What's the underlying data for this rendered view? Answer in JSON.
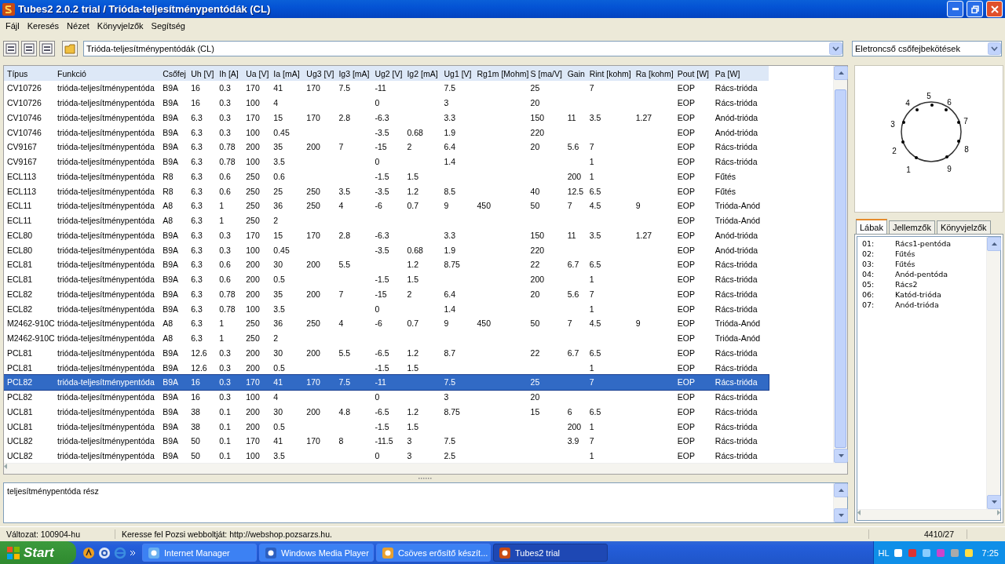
{
  "window": {
    "title": "Tubes2 2.0.2 trial / Trióda-teljesítménypentódák (CL)"
  },
  "menu": [
    "Fájl",
    "Keresés",
    "Nézet",
    "Könyvjelzők",
    "Segítség"
  ],
  "toolbar": {
    "category": "Trióda-teljesítménypentódák (CL)",
    "view": "Eletroncső csőfejbekötések"
  },
  "table": {
    "columns": [
      "Típus",
      "Funkció",
      "Csőfej",
      "Uh [V]",
      "Ih [A]",
      "Ua [V]",
      "Ia [mA]",
      "Ug3 [V]",
      "Ig3 [mA]",
      "Ug2 [V]",
      "Ig2 [mA]",
      "Ug1 [V]",
      "Rg1m [Mohm]",
      "S [ma/V]",
      "Gain",
      "Rint [kohm]",
      "Ra [kohm]",
      "Pout [W]",
      "Pa [W]"
    ],
    "rows": [
      {
        "selected": false,
        "cells": [
          "CV10726",
          "trióda-teljesítménypentóda",
          "B9A",
          "16",
          "0.3",
          "170",
          "41",
          "170",
          "7.5",
          "-11",
          null,
          "7.5",
          null,
          "25",
          null,
          "7",
          null,
          "EOP",
          "Rács-trióda"
        ]
      },
      {
        "selected": false,
        "cells": [
          "CV10726",
          "trióda-teljesítménypentóda",
          "B9A",
          "16",
          "0.3",
          "100",
          "4",
          null,
          null,
          "0",
          null,
          "3",
          null,
          "20",
          null,
          null,
          null,
          "EOP",
          "Rács-trióda"
        ]
      },
      {
        "selected": false,
        "cells": [
          "CV10746",
          "trióda-teljesítménypentóda",
          "B9A",
          "6.3",
          "0.3",
          "170",
          "15",
          "170",
          "2.8",
          "-6.3",
          null,
          "3.3",
          null,
          "150",
          "11",
          "3.5",
          "1.27",
          "EOP",
          "Anód-trióda"
        ]
      },
      {
        "selected": false,
        "cells": [
          "CV10746",
          "trióda-teljesítménypentóda",
          "B9A",
          "6.3",
          "0.3",
          "100",
          "0.45",
          null,
          null,
          "-3.5",
          "0.68",
          "1.9",
          null,
          "220",
          null,
          null,
          null,
          "EOP",
          "Anód-trióda"
        ]
      },
      {
        "selected": false,
        "cells": [
          "CV9167",
          "trióda-teljesítménypentóda",
          "B9A",
          "6.3",
          "0.78",
          "200",
          "35",
          "200",
          "7",
          "-15",
          "2",
          "6.4",
          null,
          "20",
          "5.6",
          "7",
          null,
          "EOP",
          "Rács-trióda"
        ]
      },
      {
        "selected": false,
        "cells": [
          "CV9167",
          "trióda-teljesítménypentóda",
          "B9A",
          "6.3",
          "0.78",
          "100",
          "3.5",
          null,
          null,
          "0",
          null,
          "1.4",
          null,
          null,
          null,
          "1",
          null,
          "EOP",
          "Rács-trióda"
        ]
      },
      {
        "selected": false,
        "cells": [
          "ECL113",
          "trióda-teljesítménypentóda",
          "R8",
          "6.3",
          "0.6",
          "250",
          "0.6",
          null,
          null,
          "-1.5",
          "1.5",
          null,
          null,
          null,
          "200",
          "1",
          null,
          "EOP",
          "Fűtés"
        ]
      },
      {
        "selected": false,
        "cells": [
          "ECL113",
          "trióda-teljesítménypentóda",
          "R8",
          "6.3",
          "0.6",
          "250",
          "25",
          "250",
          "3.5",
          "-3.5",
          "1.2",
          "8.5",
          null,
          "40",
          "12.5",
          "6.5",
          null,
          "EOP",
          "Fűtés"
        ]
      },
      {
        "selected": false,
        "cells": [
          "ECL11",
          "trióda-teljesítménypentóda",
          "A8",
          "6.3",
          "1",
          "250",
          "36",
          "250",
          "4",
          "-6",
          "0.7",
          "9",
          "450",
          "50",
          "7",
          "4.5",
          "9",
          "EOP",
          "Trióda-Anód"
        ]
      },
      {
        "selected": false,
        "cells": [
          "ECL11",
          "trióda-teljesítménypentóda",
          "A8",
          "6.3",
          "1",
          "250",
          "2",
          null,
          null,
          null,
          null,
          null,
          null,
          null,
          null,
          null,
          null,
          "EOP",
          "Trióda-Anód"
        ]
      },
      {
        "selected": false,
        "cells": [
          "ECL80",
          "trióda-teljesítménypentóda",
          "B9A",
          "6.3",
          "0.3",
          "170",
          "15",
          "170",
          "2.8",
          "-6.3",
          null,
          "3.3",
          null,
          "150",
          "11",
          "3.5",
          "1.27",
          "EOP",
          "Anód-trióda"
        ]
      },
      {
        "selected": false,
        "cells": [
          "ECL80",
          "trióda-teljesítménypentóda",
          "B9A",
          "6.3",
          "0.3",
          "100",
          "0.45",
          null,
          null,
          "-3.5",
          "0.68",
          "1.9",
          null,
          "220",
          null,
          null,
          null,
          "EOP",
          "Anód-trióda"
        ]
      },
      {
        "selected": false,
        "cells": [
          "ECL81",
          "trióda-teljesítménypentóda",
          "B9A",
          "6.3",
          "0.6",
          "200",
          "30",
          "200",
          "5.5",
          null,
          "1.2",
          "8.75",
          null,
          "22",
          "6.7",
          "6.5",
          null,
          "EOP",
          "Rács-trióda"
        ]
      },
      {
        "selected": false,
        "cells": [
          "ECL81",
          "trióda-teljesítménypentóda",
          "B9A",
          "6.3",
          "0.6",
          "200",
          "0.5",
          null,
          null,
          "-1.5",
          "1.5",
          null,
          null,
          "200",
          null,
          "1",
          null,
          "EOP",
          "Rács-trióda"
        ]
      },
      {
        "selected": false,
        "cells": [
          "ECL82",
          "trióda-teljesítménypentóda",
          "B9A",
          "6.3",
          "0.78",
          "200",
          "35",
          "200",
          "7",
          "-15",
          "2",
          "6.4",
          null,
          "20",
          "5.6",
          "7",
          null,
          "EOP",
          "Rács-trióda"
        ]
      },
      {
        "selected": false,
        "cells": [
          "ECL82",
          "trióda-teljesítménypentóda",
          "B9A",
          "6.3",
          "0.78",
          "100",
          "3.5",
          null,
          null,
          "0",
          null,
          "1.4",
          null,
          null,
          null,
          "1",
          null,
          "EOP",
          "Rács-trióda"
        ]
      },
      {
        "selected": false,
        "cells": [
          "M2462-910C",
          "trióda-teljesítménypentóda",
          "A8",
          "6.3",
          "1",
          "250",
          "36",
          "250",
          "4",
          "-6",
          "0.7",
          "9",
          "450",
          "50",
          "7",
          "4.5",
          "9",
          "EOP",
          "Trióda-Anód"
        ]
      },
      {
        "selected": false,
        "cells": [
          "M2462-910C",
          "trióda-teljesítménypentóda",
          "A8",
          "6.3",
          "1",
          "250",
          "2",
          null,
          null,
          null,
          null,
          null,
          null,
          null,
          null,
          null,
          null,
          "EOP",
          "Trióda-Anód"
        ]
      },
      {
        "selected": false,
        "cells": [
          "PCL81",
          "trióda-teljesítménypentóda",
          "B9A",
          "12.6",
          "0.3",
          "200",
          "30",
          "200",
          "5.5",
          "-6.5",
          "1.2",
          "8.7",
          null,
          "22",
          "6.7",
          "6.5",
          null,
          "EOP",
          "Rács-trióda"
        ]
      },
      {
        "selected": false,
        "cells": [
          "PCL81",
          "trióda-teljesítménypentóda",
          "B9A",
          "12.6",
          "0.3",
          "200",
          "0.5",
          null,
          null,
          "-1.5",
          "1.5",
          null,
          null,
          null,
          null,
          "1",
          null,
          "EOP",
          "Rács-trióda"
        ]
      },
      {
        "selected": true,
        "cells": [
          "PCL82",
          "trióda-teljesítménypentóda",
          "B9A",
          "16",
          "0.3",
          "170",
          "41",
          "170",
          "7.5",
          "-11",
          null,
          "7.5",
          null,
          "25",
          null,
          "7",
          null,
          "EOP",
          "Rács-trióda"
        ]
      },
      {
        "selected": false,
        "cells": [
          "PCL82",
          "trióda-teljesítménypentóda",
          "B9A",
          "16",
          "0.3",
          "100",
          "4",
          null,
          null,
          "0",
          null,
          "3",
          null,
          "20",
          null,
          null,
          null,
          "EOP",
          "Rács-trióda"
        ]
      },
      {
        "selected": false,
        "cells": [
          "UCL81",
          "trióda-teljesítménypentóda",
          "B9A",
          "38",
          "0.1",
          "200",
          "30",
          "200",
          "4.8",
          "-6.5",
          "1.2",
          "8.75",
          null,
          "15",
          "6",
          "6.5",
          null,
          "EOP",
          "Rács-trióda"
        ]
      },
      {
        "selected": false,
        "cells": [
          "UCL81",
          "trióda-teljesítménypentóda",
          "B9A",
          "38",
          "0.1",
          "200",
          "0.5",
          null,
          null,
          "-1.5",
          "1.5",
          null,
          null,
          null,
          "200",
          "1",
          null,
          "EOP",
          "Rács-trióda"
        ]
      },
      {
        "selected": false,
        "cells": [
          "UCL82",
          "trióda-teljesítménypentóda",
          "B9A",
          "50",
          "0.1",
          "170",
          "41",
          "170",
          "8",
          "-11.5",
          "3",
          "7.5",
          null,
          null,
          "3.9",
          "7",
          null,
          "EOP",
          "Rács-trióda"
        ]
      },
      {
        "selected": false,
        "cells": [
          "UCL82",
          "trióda-teljesítménypentóda",
          "B9A",
          "50",
          "0.1",
          "100",
          "3.5",
          null,
          null,
          "0",
          "3",
          "2.5",
          null,
          null,
          null,
          "1",
          null,
          "EOP",
          "Rács-trióda"
        ]
      }
    ]
  },
  "description": "teljesítménypentóda rész",
  "pin_diagram": {
    "pins": [
      "1",
      "2",
      "3",
      "4",
      "5",
      "6",
      "7",
      "8",
      "9"
    ]
  },
  "side_tabs": [
    {
      "label": "Lábak",
      "selected": true
    },
    {
      "label": "Jellemzők",
      "selected": false
    },
    {
      "label": "Könyvjelzők",
      "selected": false
    }
  ],
  "pin_list": [
    {
      "number": "01:",
      "name": "Rács1-pentóda"
    },
    {
      "number": "02:",
      "name": "Fűtés"
    },
    {
      "number": "03:",
      "name": "Fűtés"
    },
    {
      "number": "04:",
      "name": "Anód-pentóda"
    },
    {
      "number": "05:",
      "name": "Rács2"
    },
    {
      "number": "06:",
      "name": "Katód-trióda"
    },
    {
      "number": "07:",
      "name": "Anód-trióda"
    }
  ],
  "status_bar": {
    "version": "Változat: 100904-hu",
    "message": "Keresse fel Pozsi webboltját: http://webshop.pozsarzs.hu.",
    "count": "4410/27"
  },
  "taskbar": {
    "start": "Start",
    "items": [
      {
        "label": "Internet Manager",
        "selected": false
      },
      {
        "label": "Windows Media Player",
        "selected": false
      },
      {
        "label": "Csöves erősítő készít...",
        "selected": false
      },
      {
        "label": "Tubes2 trial",
        "selected": true
      }
    ],
    "language": "HL",
    "clock": "7:25"
  }
}
